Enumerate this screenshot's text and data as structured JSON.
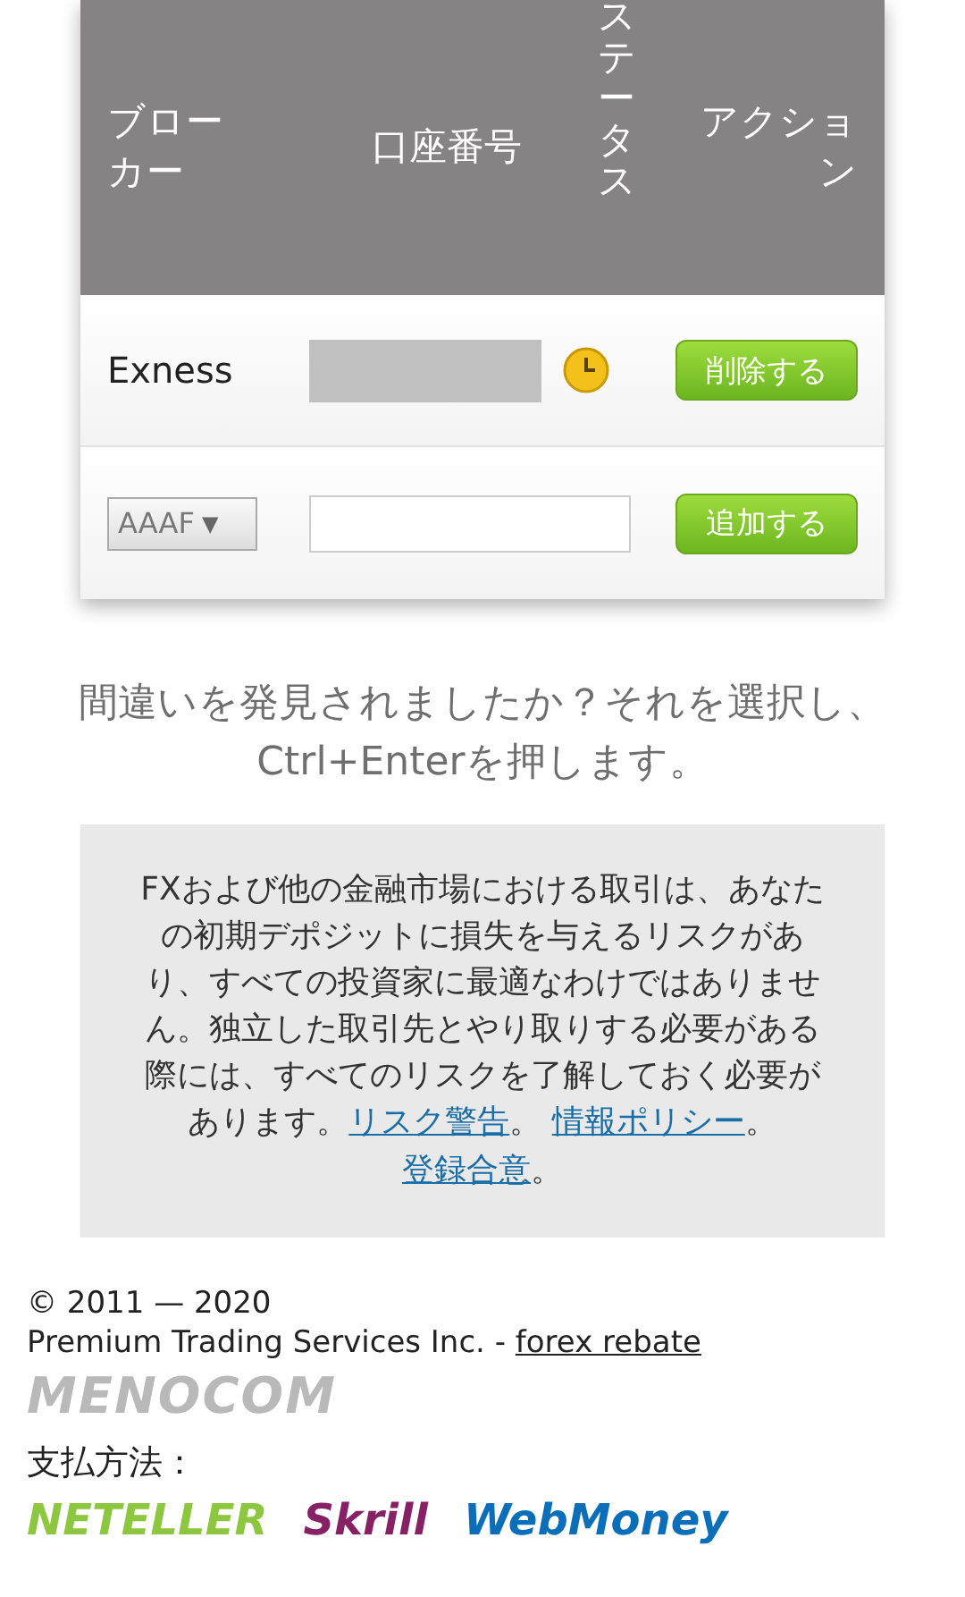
{
  "table": {
    "columns": [
      {
        "label": "ブローカー"
      },
      {
        "label": "口座番号"
      },
      {
        "label": "ステータス",
        "kind": "vertical"
      },
      {
        "label": "アクション"
      }
    ],
    "rows": [
      {
        "kind": "account",
        "broker": "Exness",
        "pending": true,
        "action": "削除する"
      },
      {
        "kind": "add",
        "broker_select": {
          "value": "AAAF",
          "caret": "▼"
        },
        "action": "追加する"
      }
    ]
  },
  "error_notice": "間違いを発見されましたか？それを選択し、Ctrl+Enterを押します。",
  "risk_warning": [
    {
      "kind": "text",
      "text": "FXおよび他の金融市場における取引は、あなたの初期デポジットに損失を与えるリスクがあり、すべての投資家に最適なわけではありません。独立した取引先とやり取りする必要がある際には、すべてのリスクを了解しておく必要があります。"
    },
    {
      "kind": "link",
      "text": "リスク警告"
    },
    {
      "kind": "text",
      "text": "。"
    },
    {
      "kind": "link",
      "text": "情報ポリシー"
    },
    {
      "kind": "text",
      "text": "。"
    },
    {
      "kind": "link",
      "text": "登録合意"
    },
    {
      "kind": "text",
      "text": "。"
    }
  ],
  "footer": {
    "copyright": "© 2011 — 2020",
    "company": "Premium Trading Services Inc. -",
    "link": "forex rebate",
    "logo": "MENOCOM",
    "payment_label": "支払方法：",
    "payment_logos": [
      {
        "label": "NETELLER",
        "color": "#8dc63f"
      },
      {
        "label": "Skrill",
        "color": "#862165"
      },
      {
        "label": "WebMoney",
        "color": "#0a6fb8"
      }
    ]
  }
}
